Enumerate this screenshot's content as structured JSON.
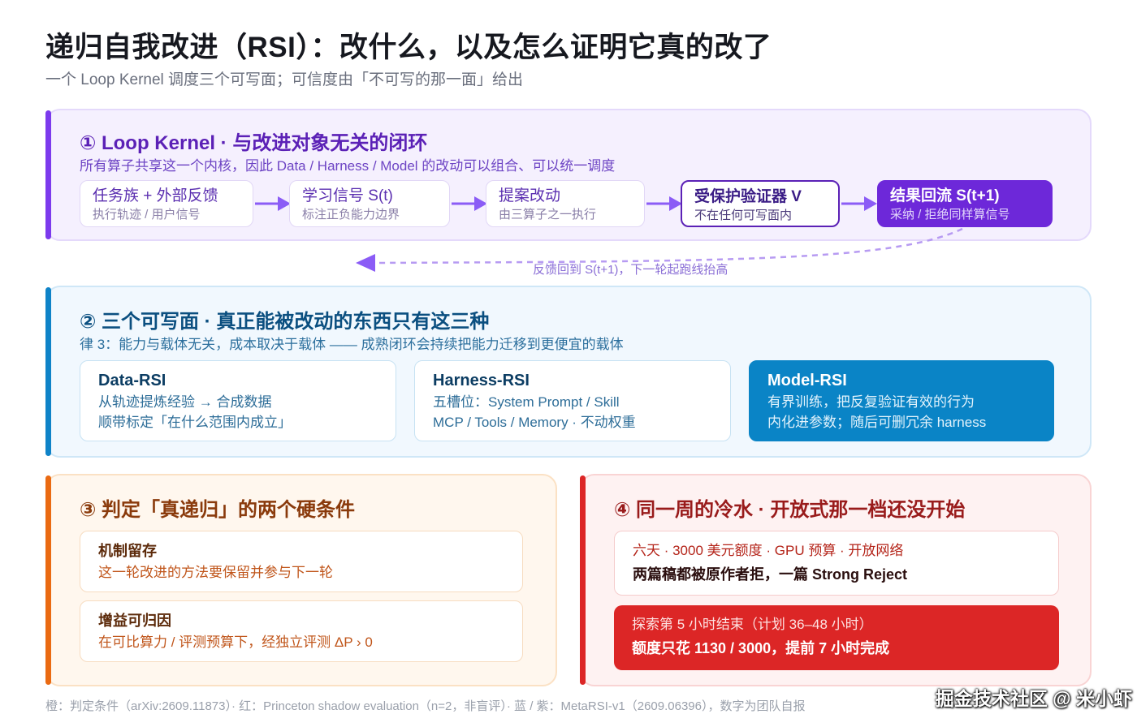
{
  "header": {
    "title": "递归自我改进（RSI）：改什么，以及怎么证明它真的改了",
    "subtitle": "一个 Loop Kernel 调度三个可写面；可信度由「不可写的那一面」给出"
  },
  "loop_kernel": {
    "title": "① Loop Kernel · 与改进对象无关的闭环",
    "subtitle": "所有算子共享这一个内核，因此 Data / Harness / Model 的改动可以组合、可以统一调度",
    "steps": [
      {
        "title": "任务族 + 外部反馈",
        "sub": "执行轨迹 / 用户信号"
      },
      {
        "title": "学习信号 S(t)",
        "sub": "标注正负能力边界"
      },
      {
        "title": "提案改动",
        "sub": "由三算子之一执行"
      },
      {
        "title": "受保护验证器 V",
        "sub": "不在任何可写面内"
      },
      {
        "title": "结果回流 S(t+1)",
        "sub": "采纳 / 拒绝同样算信号"
      }
    ],
    "feedback_label": "反馈回到 S(t+1)，下一轮起跑线抬高"
  },
  "writable_surfaces": {
    "title": "② 三个可写面 · 真正能被改动的东西只有这三种",
    "subtitle": "律 3：能力与载体无关，成本取决于载体 —— 成熟闭环会持续把能力迁移到更便宜的载体",
    "cards": [
      {
        "title": "Data-RSI",
        "line1": "从轨迹提炼经验 → 合成数据",
        "line2": "顺带标定「在什么范围内成立」"
      },
      {
        "title": "Harness-RSI",
        "line1": "五槽位：System Prompt / Skill",
        "line2": "MCP / Tools / Memory · 不动权重"
      },
      {
        "title": "Model-RSI",
        "line1": "有界训练，把反复验证有效的行为",
        "line2": "内化进参数；随后可删冗余 harness"
      }
    ]
  },
  "conditions": {
    "title": "③ 判定「真递归」的两个硬条件",
    "cards": [
      {
        "title": "机制留存",
        "line": "这一轮改进的方法要保留并参与下一轮"
      },
      {
        "title": "增益可归因",
        "line": "在可比算力 / 评测预算下，经独立评测 ΔP › 0"
      }
    ]
  },
  "cold_water": {
    "title": "④ 同一周的冷水 · 开放式那一档还没开始",
    "cards": [
      {
        "line1": "六天 · 3000 美元额度 · GPU 预算 · 开放网络",
        "line2": "两篇稿都被原作者拒，一篇 Strong Reject"
      },
      {
        "line1": "探索第 5 小时结束（计划 36–48 小时）",
        "line2": "额度只花 1130 / 3000，提前 7 小时完成"
      }
    ]
  },
  "footnote": "橙：判定条件（arXiv:2609.11873）· 红：Princeton shadow evaluation（n=2，非盲评）· 蓝 / 紫：MetaRSI-v1（2609.06396），数字为团队自报",
  "watermark": "掘金技术社区 @ 米小虾",
  "colors": {
    "purple": "#7c3aed",
    "blue": "#0f83c8",
    "orange": "#ea6a12",
    "red": "#dc2626"
  }
}
